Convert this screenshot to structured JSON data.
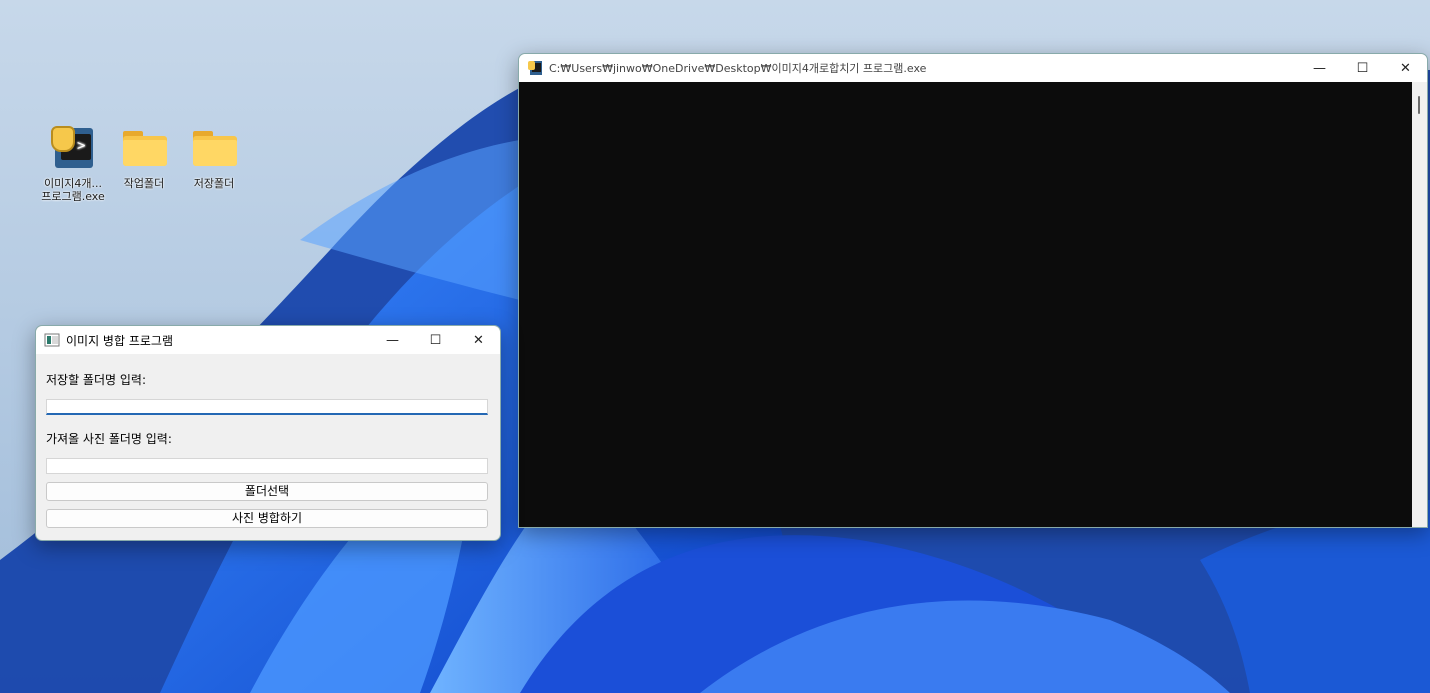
{
  "desktop": {
    "icons": [
      {
        "label_line1": "이미지4개...",
        "label_line2": "프로그램.exe",
        "icon": "python-exe-icon"
      },
      {
        "label": "작업폴더",
        "icon": "folder-icon"
      },
      {
        "label": "저장폴더",
        "icon": "folder-icon"
      }
    ]
  },
  "console_window": {
    "title": "C:₩Users₩jinwo₩OneDrive₩Desktop₩이미지4개로합치기 프로그램.exe",
    "background": "#0c0c0c"
  },
  "merge_window": {
    "title": "이미지 병합 프로그램",
    "save_folder_label": "저장할 폴더명 입력:",
    "save_folder_value": "",
    "source_folder_label": "가져올 사진 폴더명 입력:",
    "source_folder_value": "",
    "select_folder_button": "폴더선택",
    "merge_button": "사진 병합하기"
  },
  "caption": {
    "minimize": "—",
    "maximize": "☐",
    "close": "✕"
  },
  "colors": {
    "accent": "#2468b4",
    "wallpaper_blue": "#1a5fe6"
  }
}
